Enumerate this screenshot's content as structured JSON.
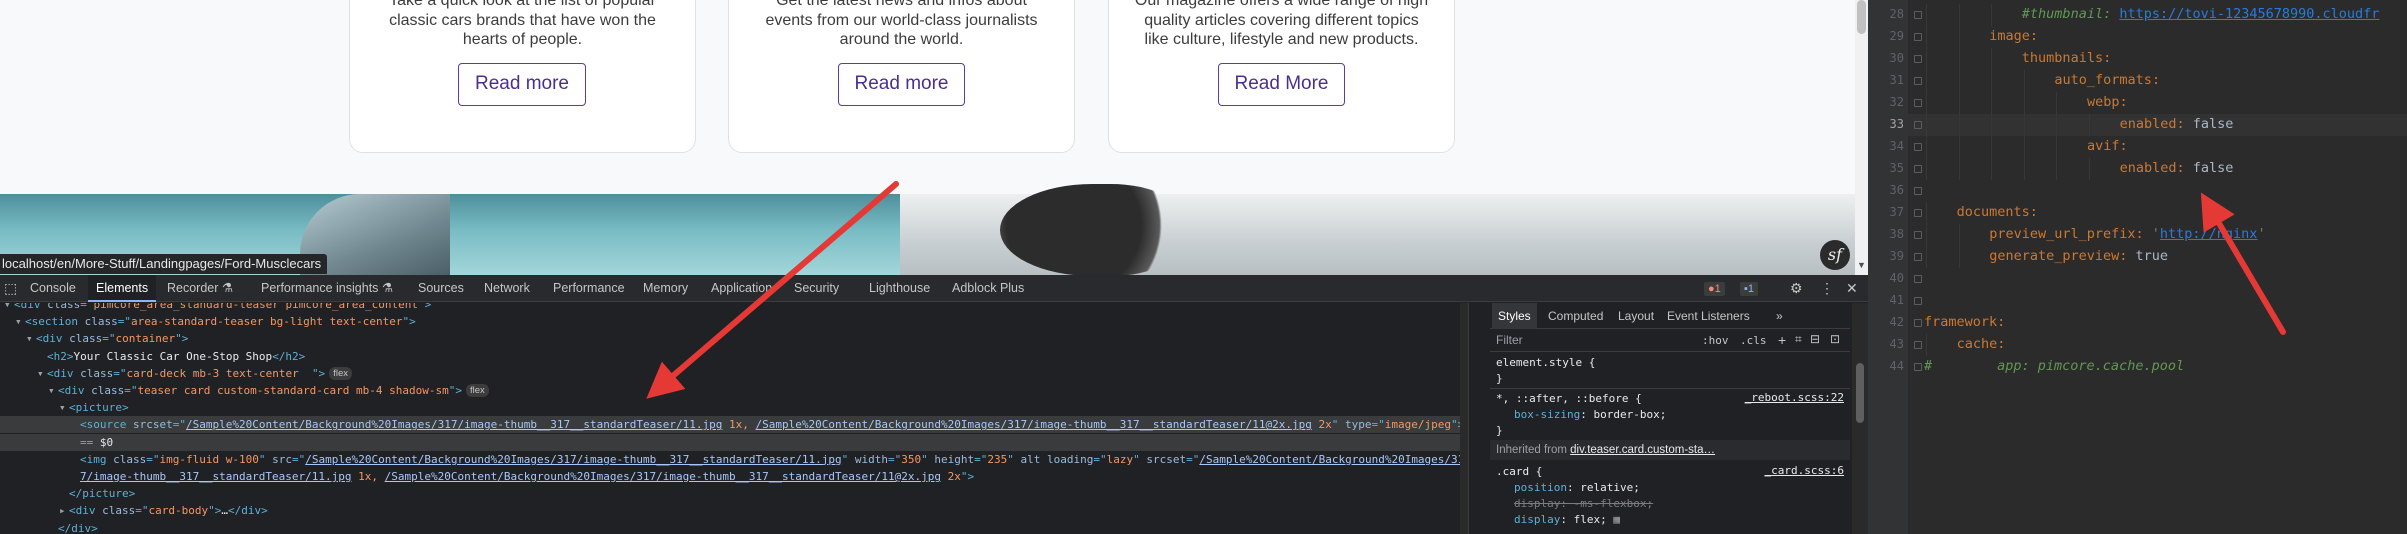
{
  "website": {
    "cards": [
      {
        "text_lines": [
          "Take a quick look at the list of popular",
          "classic cars brands that have won the",
          "hearts of people."
        ],
        "button": "Read more"
      },
      {
        "text_lines": [
          "Get the latest news and infos about",
          "events from our world-class journalists",
          "around the world."
        ],
        "button": "Read more"
      },
      {
        "text_lines": [
          "Our magazine offers a wide range of high",
          "quality articles covering different topics",
          "like culture, lifestyle and new products."
        ],
        "button": "Read More"
      }
    ],
    "status_url": "localhost/en/More-Stuff/Landingpages/Ford-Musclecars",
    "symfony_badge": "sf"
  },
  "devtools": {
    "tabs": [
      "Console",
      "Elements",
      "Recorder ⚗",
      "Performance insights ⚗",
      "Sources",
      "Network",
      "Performance",
      "Memory",
      "Application",
      "Security",
      "Lighthouse",
      "Adblock Plus"
    ],
    "active_tab": "Elements",
    "error_count": "1",
    "info_count": "1",
    "icons": {
      "errors": "error-icon",
      "messages": "message-icon",
      "settings": "gear-icon",
      "more": "kebab-icon",
      "close": "close-icon"
    },
    "dom_lines": [
      {
        "indent": 0,
        "arrow": "▾",
        "parts": [
          [
            "tg",
            "<div "
          ],
          [
            "an",
            "class"
          ],
          [
            "tg",
            "=\""
          ],
          [
            "av",
            "pimcore_area_standard-teaser pimcore_area_content"
          ],
          [
            "tg",
            "\">"
          ]
        ]
      },
      {
        "indent": 1,
        "arrow": "▾",
        "parts": [
          [
            "tg",
            "<section "
          ],
          [
            "an",
            "class"
          ],
          [
            "tg",
            "=\""
          ],
          [
            "av",
            "area-standard-teaser bg-light text-center"
          ],
          [
            "tg",
            "\">"
          ]
        ]
      },
      {
        "indent": 2,
        "arrow": "▾",
        "parts": [
          [
            "tg",
            "<div "
          ],
          [
            "an",
            "class"
          ],
          [
            "tg",
            "=\""
          ],
          [
            "av",
            "container"
          ],
          [
            "tg",
            "\">"
          ]
        ]
      },
      {
        "indent": 3,
        "arrow": "",
        "parts": [
          [
            "tg",
            "<h2>"
          ],
          [
            "tx",
            "Your Classic Car One-Stop Shop"
          ],
          [
            "tg",
            "</h2>"
          ]
        ]
      },
      {
        "indent": 3,
        "arrow": "▾",
        "parts": [
          [
            "tg",
            "<div "
          ],
          [
            "an",
            "class"
          ],
          [
            "tg",
            "=\""
          ],
          [
            "av",
            "card-deck mb-3 text-center  "
          ],
          [
            "tg",
            "\">"
          ]
        ],
        "pill": "flex"
      },
      {
        "indent": 4,
        "arrow": "▾",
        "parts": [
          [
            "tg",
            "<div "
          ],
          [
            "an",
            "class"
          ],
          [
            "tg",
            "=\""
          ],
          [
            "av",
            "teaser card custom-standard-card mb-4 shadow-sm"
          ],
          [
            "tg",
            "\">"
          ]
        ],
        "pill": "flex"
      },
      {
        "indent": 5,
        "arrow": "▾",
        "parts": [
          [
            "tg",
            "<picture>"
          ]
        ]
      },
      {
        "indent": 6,
        "arrow": "",
        "selected": true,
        "parts": [
          [
            "tg",
            "<source "
          ],
          [
            "an",
            "srcset"
          ],
          [
            "tg",
            "=\""
          ],
          [
            "lk",
            "/Sample%20Content/Background%20Images/317/image-thumb__317__standardTeaser/11.jpg"
          ],
          [
            "av",
            " 1x, "
          ],
          [
            "lk",
            "/Sample%20Content/Background%20Images/317/image-thumb__317__standardTeaser/11@2x.jpg"
          ],
          [
            "av",
            " 2x"
          ],
          [
            "tg",
            "\" "
          ],
          [
            "an",
            "type"
          ],
          [
            "tg",
            "=\""
          ],
          [
            "av",
            "image/jpeg"
          ],
          [
            "tg",
            "\">"
          ]
        ]
      },
      {
        "indent": 6,
        "arrow": "",
        "selected": true,
        "parts": [
          [
            "ar",
            "== "
          ],
          [
            "tx",
            "$0"
          ]
        ]
      },
      {
        "indent": 6,
        "arrow": "",
        "parts": [
          [
            "tg",
            "<img "
          ],
          [
            "an",
            "class"
          ],
          [
            "tg",
            "=\""
          ],
          [
            "av",
            "img-fluid w-100"
          ],
          [
            "tg",
            "\" "
          ],
          [
            "an",
            "src"
          ],
          [
            "tg",
            "=\""
          ],
          [
            "lk",
            "/Sample%20Content/Background%20Images/317/image-thumb__317__standardTeaser/11.jpg"
          ],
          [
            "tg",
            "\" "
          ],
          [
            "an",
            "width"
          ],
          [
            "tg",
            "=\""
          ],
          [
            "av",
            "350"
          ],
          [
            "tg",
            "\" "
          ],
          [
            "an",
            "height"
          ],
          [
            "tg",
            "=\""
          ],
          [
            "av",
            "235"
          ],
          [
            "tg",
            "\" "
          ],
          [
            "an",
            "alt loading"
          ],
          [
            "tg",
            "=\""
          ],
          [
            "av",
            "lazy"
          ],
          [
            "tg",
            "\" "
          ],
          [
            "an",
            "srcset"
          ],
          [
            "tg",
            "=\""
          ],
          [
            "lk",
            "/Sample%20Content/Background%20Images/31"
          ]
        ]
      },
      {
        "indent": 6,
        "arrow": "",
        "parts": [
          [
            "lk",
            "7/image-thumb__317__standardTeaser/11.jpg"
          ],
          [
            "av",
            " 1x, "
          ],
          [
            "lk",
            "/Sample%20Content/Background%20Images/317/image-thumb__317__standardTeaser/11@2x.jpg"
          ],
          [
            "av",
            " 2x"
          ],
          [
            "tg",
            "\">"
          ]
        ]
      },
      {
        "indent": 5,
        "arrow": "",
        "parts": [
          [
            "tg",
            "</picture>"
          ]
        ]
      },
      {
        "indent": 5,
        "arrow": "▸",
        "parts": [
          [
            "tg",
            "<div "
          ],
          [
            "an",
            "class"
          ],
          [
            "tg",
            "=\""
          ],
          [
            "av",
            "card-body"
          ],
          [
            "tg",
            "\">"
          ],
          [
            "tx",
            "…"
          ],
          [
            "tg",
            "</div>"
          ]
        ]
      },
      {
        "indent": 4,
        "arrow": "",
        "parts": [
          [
            "tg",
            "</div>"
          ]
        ]
      }
    ],
    "styles": {
      "tabs": [
        "Styles",
        "Computed",
        "Layout",
        "Event Listeners",
        "»"
      ],
      "active_tab": "Styles",
      "filter_placeholder": "Filter",
      "hov": ":hov",
      "cls": ".cls",
      "element_style": "element.style {",
      "close_brace": "}",
      "universal_selector": "*, ::after, ::before {",
      "universal_source": "_reboot.scss:22",
      "box_sizing_prop": "box-sizing",
      "box_sizing_val": "border-box;",
      "inherited_label": "Inherited from ",
      "inherited_link": "div.teaser.card.custom-sta…",
      "card_selector": ".card {",
      "card_source": "_card.scss:6",
      "position_prop": "position",
      "position_val": "relative;",
      "msflexbox": "display: -ms-flexbox;",
      "display_prop": "display",
      "display_val": "flex;"
    }
  },
  "editor": {
    "current_line": 33,
    "lines": [
      {
        "n": 28,
        "indent": 3,
        "parts": [
          [
            "c",
            "#thumbnail: "
          ],
          [
            "u",
            "https://tovi-12345678990.cloudfr"
          ]
        ]
      },
      {
        "n": 29,
        "indent": 2,
        "parts": [
          [
            "k",
            "image"
          ],
          [
            "y",
            ":"
          ]
        ]
      },
      {
        "n": 30,
        "indent": 3,
        "parts": [
          [
            "k",
            "thumbnails"
          ],
          [
            "y",
            ":"
          ]
        ]
      },
      {
        "n": 31,
        "indent": 4,
        "parts": [
          [
            "k",
            "auto_formats"
          ],
          [
            "y",
            ":"
          ]
        ]
      },
      {
        "n": 32,
        "indent": 5,
        "parts": [
          [
            "k",
            "webp"
          ],
          [
            "y",
            ":"
          ]
        ]
      },
      {
        "n": 33,
        "indent": 6,
        "parts": [
          [
            "k",
            "enabled"
          ],
          [
            "y",
            ": "
          ],
          [
            "v",
            "false"
          ]
        ]
      },
      {
        "n": 34,
        "indent": 5,
        "parts": [
          [
            "k",
            "avif"
          ],
          [
            "y",
            ":"
          ]
        ]
      },
      {
        "n": 35,
        "indent": 6,
        "parts": [
          [
            "k",
            "enabled"
          ],
          [
            "y",
            ": "
          ],
          [
            "v",
            "false"
          ]
        ]
      },
      {
        "n": 36,
        "indent": 0,
        "parts": []
      },
      {
        "n": 37,
        "indent": 1,
        "parts": [
          [
            "k",
            "documents"
          ],
          [
            "y",
            ":"
          ]
        ]
      },
      {
        "n": 38,
        "indent": 2,
        "parts": [
          [
            "k",
            "preview_url_prefix"
          ],
          [
            "y",
            ": "
          ],
          [
            "s",
            "'"
          ],
          [
            "u",
            "http://nginx"
          ],
          [
            "s",
            "'"
          ]
        ]
      },
      {
        "n": 39,
        "indent": 2,
        "parts": [
          [
            "k",
            "generate_preview"
          ],
          [
            "y",
            ": "
          ],
          [
            "v",
            "true"
          ]
        ]
      },
      {
        "n": 40,
        "indent": 0,
        "parts": []
      },
      {
        "n": 41,
        "indent": 0,
        "parts": []
      },
      {
        "n": 42,
        "indent": 0,
        "parts": [
          [
            "k",
            "framework"
          ],
          [
            "y",
            ":"
          ]
        ]
      },
      {
        "n": 43,
        "indent": 1,
        "parts": [
          [
            "k",
            "cache"
          ],
          [
            "y",
            ":"
          ]
        ]
      },
      {
        "n": 44,
        "indent": 0,
        "parts": [
          [
            "c",
            "#        app: pimcore.cache.pool"
          ]
        ]
      }
    ]
  },
  "colors": {
    "accent_purple": "#4b2f8e",
    "arrow_red": "#e53935",
    "devtools_bg": "#202124",
    "editor_bg": "#2b2b2b"
  }
}
